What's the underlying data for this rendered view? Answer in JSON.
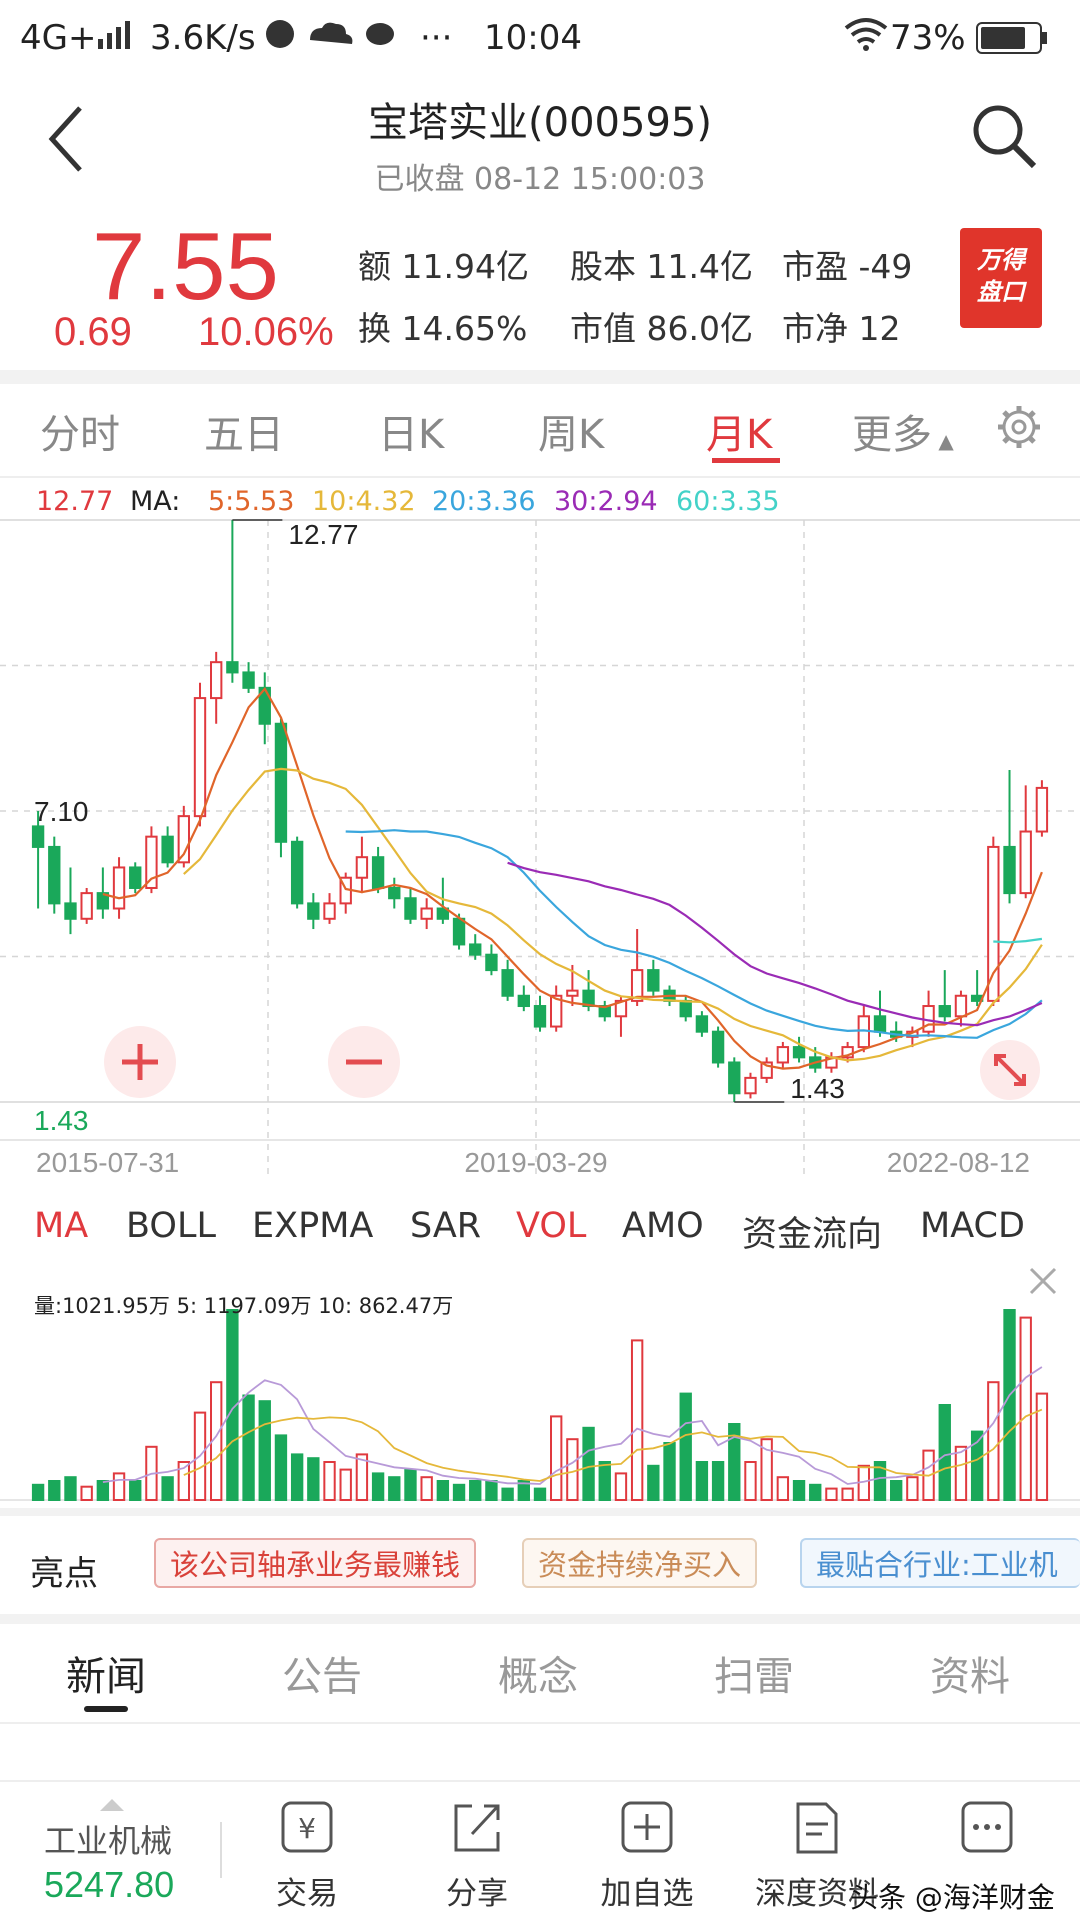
{
  "status_bar": {
    "network": "4G+",
    "speed": "3.6K/s",
    "time": "10:04",
    "battery": "73%"
  },
  "header": {
    "title": "宝塔实业(000595)",
    "subtitle": "已收盘 08-12 15:00:03"
  },
  "quote": {
    "price": "7.55",
    "change": "0.69",
    "change_pct": "10.06%",
    "stats": [
      {
        "label": "额",
        "value": "11.94亿"
      },
      {
        "label": "股本",
        "value": "11.4亿"
      },
      {
        "label": "市盈",
        "value": "-49"
      },
      {
        "label": "换",
        "value": "14.65%"
      },
      {
        "label": "市值",
        "value": "86.0亿"
      },
      {
        "label": "市净",
        "value": "12"
      }
    ],
    "badge_line1": "万得",
    "badge_line2": "盘口"
  },
  "period_tabs": [
    {
      "label": "分时"
    },
    {
      "label": "五日"
    },
    {
      "label": "日K"
    },
    {
      "label": "周K"
    },
    {
      "label": "月K",
      "active": true
    },
    {
      "label": "更多"
    }
  ],
  "ma_legend": {
    "high": "12.77",
    "ma_label": "MA:",
    "items": [
      {
        "label": "5:5.53",
        "color": "#e0652a"
      },
      {
        "label": "10:4.32",
        "color": "#e5b83a"
      },
      {
        "label": "20:3.36",
        "color": "#3aa6dd"
      },
      {
        "label": "30:2.94",
        "color": "#9a2bb5"
      },
      {
        "label": "60:3.35",
        "color": "#43d2c8"
      }
    ]
  },
  "chart_data": {
    "type": "candlestick",
    "period": "monthly",
    "x_tick_labels": [
      "2015-07-31",
      "2019-03-29",
      "2022-08-12"
    ],
    "price_labels": {
      "max": "12.77",
      "min": "1.43",
      "level": "7.10",
      "axis_high": "12.77",
      "axis_low": "1.43"
    },
    "ylim": [
      1.43,
      12.77
    ],
    "candles": [
      {
        "o": 6.8,
        "h": 7.1,
        "l": 5.2,
        "c": 6.4
      },
      {
        "o": 6.4,
        "h": 6.6,
        "l": 5.1,
        "c": 5.3
      },
      {
        "o": 5.3,
        "h": 6.0,
        "l": 4.7,
        "c": 5.0
      },
      {
        "o": 5.0,
        "h": 5.6,
        "l": 4.9,
        "c": 5.5
      },
      {
        "o": 5.5,
        "h": 6.0,
        "l": 5.0,
        "c": 5.2
      },
      {
        "o": 5.2,
        "h": 6.2,
        "l": 5.0,
        "c": 6.0
      },
      {
        "o": 6.0,
        "h": 6.1,
        "l": 5.5,
        "c": 5.6
      },
      {
        "o": 5.6,
        "h": 6.8,
        "l": 5.5,
        "c": 6.6
      },
      {
        "o": 6.6,
        "h": 6.8,
        "l": 6.0,
        "c": 6.1
      },
      {
        "o": 6.1,
        "h": 7.2,
        "l": 6.0,
        "c": 7.0
      },
      {
        "o": 7.0,
        "h": 9.6,
        "l": 6.8,
        "c": 9.3
      },
      {
        "o": 9.3,
        "h": 10.2,
        "l": 8.8,
        "c": 10.0
      },
      {
        "o": 10.0,
        "h": 12.77,
        "l": 9.6,
        "c": 9.8
      },
      {
        "o": 9.8,
        "h": 10.0,
        "l": 9.4,
        "c": 9.5
      },
      {
        "o": 9.5,
        "h": 9.8,
        "l": 8.4,
        "c": 8.8
      },
      {
        "o": 8.8,
        "h": 8.9,
        "l": 6.2,
        "c": 6.5
      },
      {
        "o": 6.5,
        "h": 6.6,
        "l": 5.2,
        "c": 5.3
      },
      {
        "o": 5.3,
        "h": 5.5,
        "l": 4.8,
        "c": 5.0
      },
      {
        "o": 5.0,
        "h": 5.5,
        "l": 4.9,
        "c": 5.3
      },
      {
        "o": 5.3,
        "h": 5.9,
        "l": 5.1,
        "c": 5.8
      },
      {
        "o": 5.8,
        "h": 6.6,
        "l": 5.5,
        "c": 6.2
      },
      {
        "o": 6.2,
        "h": 6.4,
        "l": 5.5,
        "c": 5.6
      },
      {
        "o": 5.6,
        "h": 5.8,
        "l": 5.2,
        "c": 5.4
      },
      {
        "o": 5.4,
        "h": 5.6,
        "l": 4.9,
        "c": 5.0
      },
      {
        "o": 5.0,
        "h": 5.4,
        "l": 4.8,
        "c": 5.2
      },
      {
        "o": 5.2,
        "h": 5.8,
        "l": 4.9,
        "c": 5.0
      },
      {
        "o": 5.0,
        "h": 5.1,
        "l": 4.4,
        "c": 4.5
      },
      {
        "o": 4.5,
        "h": 4.7,
        "l": 4.2,
        "c": 4.3
      },
      {
        "o": 4.3,
        "h": 4.5,
        "l": 3.9,
        "c": 4.0
      },
      {
        "o": 4.0,
        "h": 4.2,
        "l": 3.4,
        "c": 3.5
      },
      {
        "o": 3.5,
        "h": 3.7,
        "l": 3.2,
        "c": 3.3
      },
      {
        "o": 3.3,
        "h": 3.5,
        "l": 2.8,
        "c": 2.9
      },
      {
        "o": 2.9,
        "h": 3.7,
        "l": 2.8,
        "c": 3.5
      },
      {
        "o": 3.5,
        "h": 4.1,
        "l": 3.3,
        "c": 3.6
      },
      {
        "o": 3.6,
        "h": 4.0,
        "l": 3.2,
        "c": 3.3
      },
      {
        "o": 3.3,
        "h": 3.4,
        "l": 3.0,
        "c": 3.1
      },
      {
        "o": 3.1,
        "h": 3.5,
        "l": 2.7,
        "c": 3.4
      },
      {
        "o": 3.4,
        "h": 4.8,
        "l": 3.3,
        "c": 4.0
      },
      {
        "o": 4.0,
        "h": 4.2,
        "l": 3.5,
        "c": 3.6
      },
      {
        "o": 3.6,
        "h": 3.7,
        "l": 3.3,
        "c": 3.4
      },
      {
        "o": 3.4,
        "h": 3.5,
        "l": 3.0,
        "c": 3.1
      },
      {
        "o": 3.1,
        "h": 3.2,
        "l": 2.7,
        "c": 2.8
      },
      {
        "o": 2.8,
        "h": 2.9,
        "l": 2.1,
        "c": 2.2
      },
      {
        "o": 2.2,
        "h": 2.3,
        "l": 1.43,
        "c": 1.6
      },
      {
        "o": 1.6,
        "h": 2.0,
        "l": 1.5,
        "c": 1.9
      },
      {
        "o": 1.9,
        "h": 2.3,
        "l": 1.8,
        "c": 2.2
      },
      {
        "o": 2.2,
        "h": 2.6,
        "l": 2.1,
        "c": 2.5
      },
      {
        "o": 2.5,
        "h": 2.7,
        "l": 2.2,
        "c": 2.3
      },
      {
        "o": 2.3,
        "h": 2.5,
        "l": 2.0,
        "c": 2.1
      },
      {
        "o": 2.1,
        "h": 2.4,
        "l": 2.0,
        "c": 2.3
      },
      {
        "o": 2.3,
        "h": 2.6,
        "l": 2.2,
        "c": 2.5
      },
      {
        "o": 2.5,
        "h": 3.3,
        "l": 2.4,
        "c": 3.1
      },
      {
        "o": 3.1,
        "h": 3.6,
        "l": 2.7,
        "c": 2.8
      },
      {
        "o": 2.8,
        "h": 3.0,
        "l": 2.6,
        "c": 2.7
      },
      {
        "o": 2.7,
        "h": 2.9,
        "l": 2.5,
        "c": 2.8
      },
      {
        "o": 2.8,
        "h": 3.6,
        "l": 2.7,
        "c": 3.3
      },
      {
        "o": 3.3,
        "h": 4.0,
        "l": 3.0,
        "c": 3.1
      },
      {
        "o": 3.1,
        "h": 3.6,
        "l": 2.9,
        "c": 3.5
      },
      {
        "o": 3.5,
        "h": 4.0,
        "l": 3.3,
        "c": 3.4
      },
      {
        "o": 3.4,
        "h": 6.6,
        "l": 3.3,
        "c": 6.4
      },
      {
        "o": 6.4,
        "h": 7.9,
        "l": 5.3,
        "c": 5.5
      },
      {
        "o": 5.5,
        "h": 7.6,
        "l": 5.4,
        "c": 6.7
      },
      {
        "o": 6.7,
        "h": 7.7,
        "l": 6.6,
        "c": 7.55
      }
    ],
    "ma_series": [
      {
        "name": "5",
        "color": "#e0652a"
      },
      {
        "name": "10",
        "color": "#e5b83a"
      },
      {
        "name": "20",
        "color": "#3aa6dd"
      },
      {
        "name": "30",
        "color": "#9a2bb5"
      },
      {
        "name": "60",
        "color": "#43d2c8"
      }
    ],
    "volume_legend": {
      "vol": "量:1021.95万",
      "ma5": "5: 1197.09万",
      "ma10": "10: 862.47万"
    }
  },
  "indicator_tabs": [
    {
      "label": "MA",
      "red": true
    },
    {
      "label": "BOLL"
    },
    {
      "label": "EXPMA"
    },
    {
      "label": "SAR"
    },
    {
      "label": "VOL",
      "red": true
    },
    {
      "label": "AMO"
    },
    {
      "label": "资金流向"
    },
    {
      "label": "MACD"
    }
  ],
  "highlights": {
    "label": "亮点",
    "tags": [
      {
        "text": "该公司轴承业务最赚钱",
        "color": "#d9423a",
        "bg": "#fdf1f0"
      },
      {
        "text": "资金持续净买入",
        "color": "#c98b57",
        "bg": "#fdf7f1"
      },
      {
        "text": "最贴合行业:工业机",
        "color": "#4a8fd0",
        "bg": "#f1f7fd"
      }
    ]
  },
  "news_tabs": [
    {
      "label": "新闻",
      "active": true
    },
    {
      "label": "公告"
    },
    {
      "label": "概念"
    },
    {
      "label": "扫雷"
    },
    {
      "label": "资料"
    }
  ],
  "bottom_bar": {
    "sector_name": "工业机械",
    "sector_value": "5247.80",
    "items": [
      {
        "label": "交易",
        "icon": "yen-icon"
      },
      {
        "label": "分享",
        "icon": "share-icon"
      },
      {
        "label": "加自选",
        "icon": "add-icon"
      },
      {
        "label": "深度资料",
        "icon": "document-icon"
      },
      {
        "label": "",
        "icon": "more-icon"
      }
    ],
    "watermark": "头条 @海洋财金"
  },
  "colors": {
    "up": "#e0393e",
    "down": "#1aa85a",
    "grid": "#d6d6d6"
  }
}
